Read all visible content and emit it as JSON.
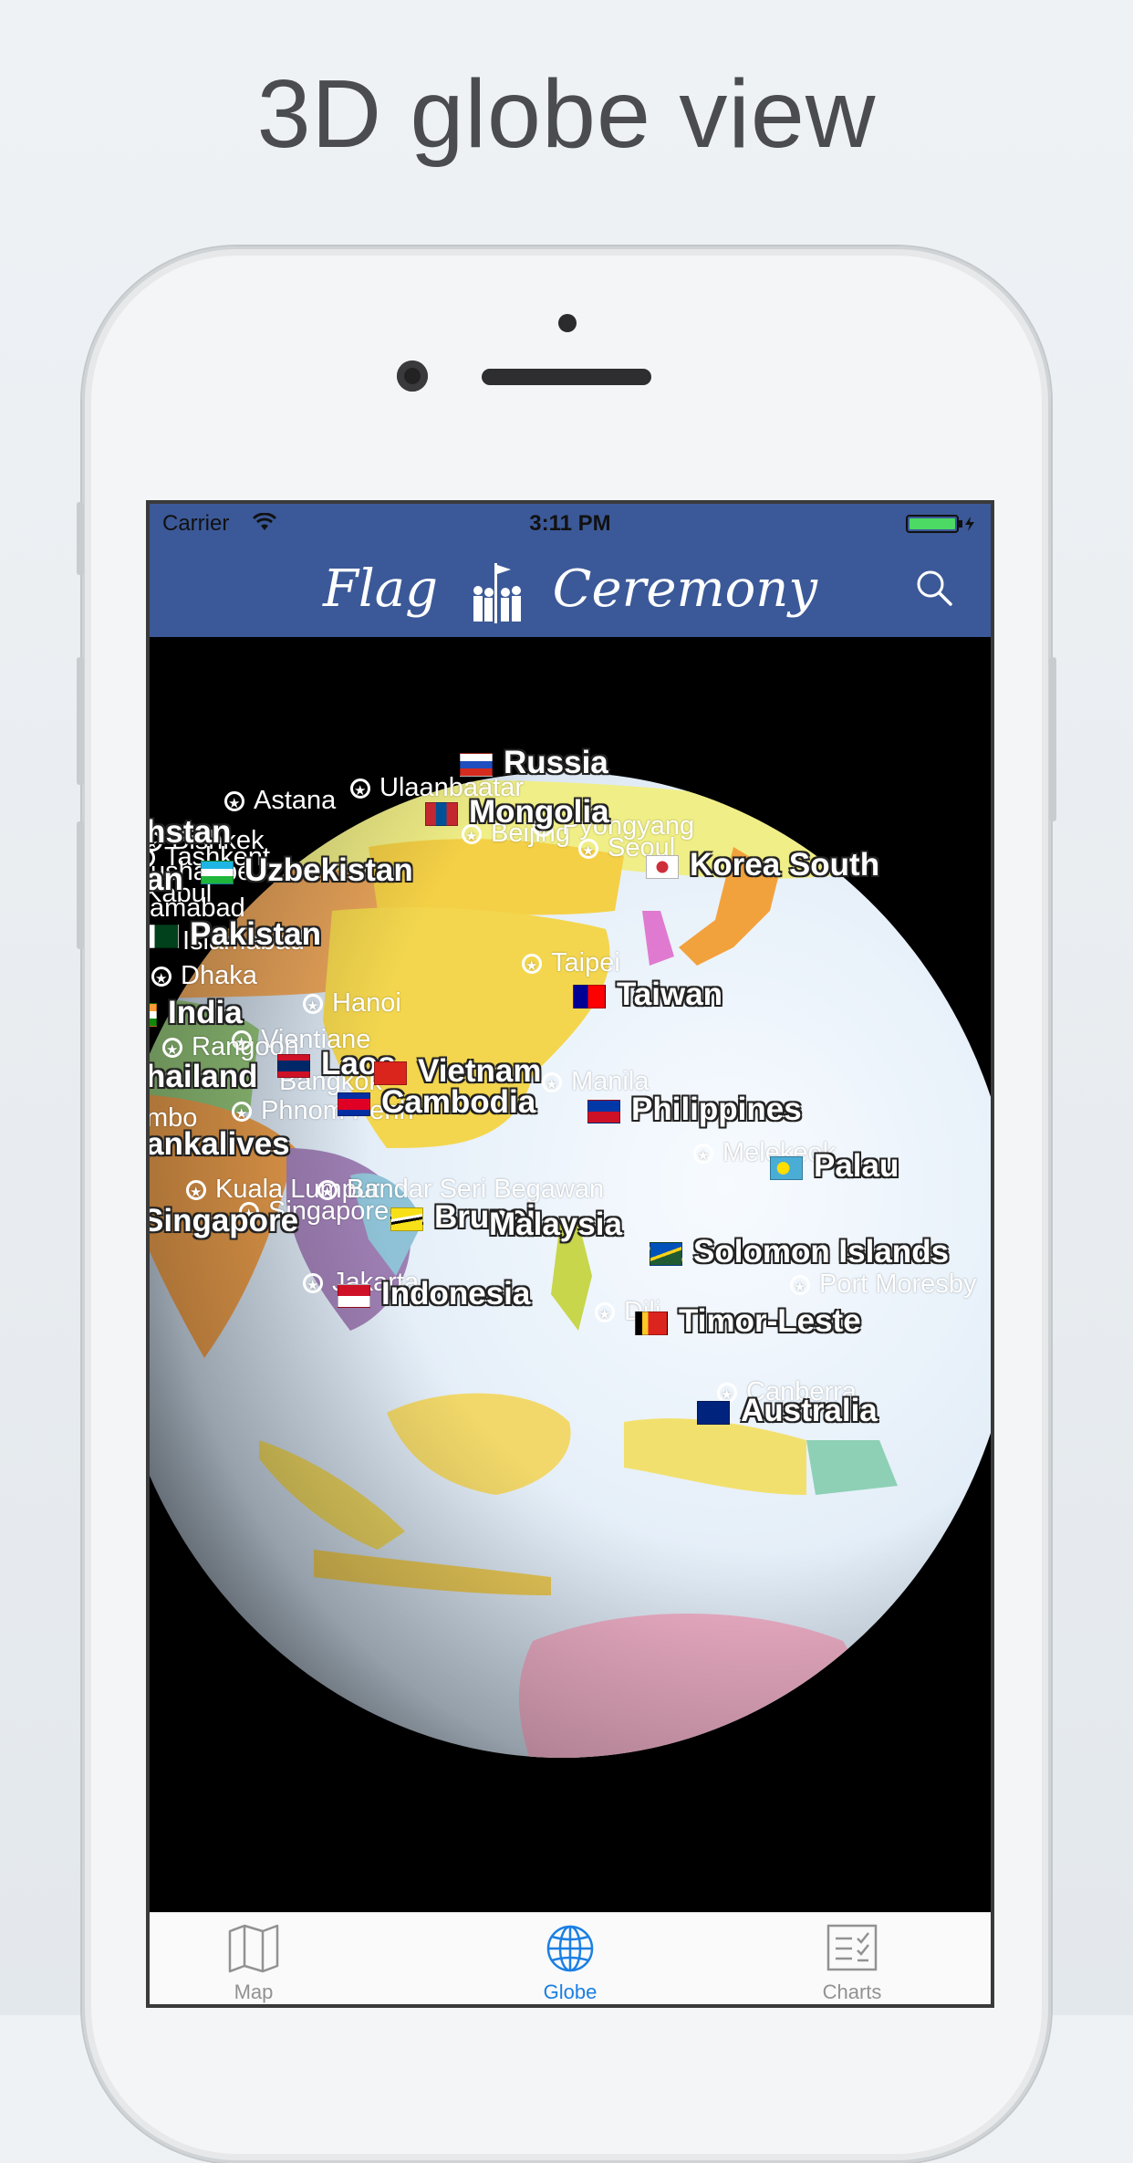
{
  "headline": "3D globe view",
  "status_bar": {
    "carrier": "Carrier",
    "time": "3:11 PM"
  },
  "nav": {
    "title_left": "Flag",
    "title_right": "Ceremony"
  },
  "countries": [
    {
      "name": "Russia",
      "flag": "ru"
    },
    {
      "name": "Mongolia",
      "flag": "mn"
    },
    {
      "name": "hstan",
      "flag": ""
    },
    {
      "name": "Uzbekistan",
      "flag": "uz"
    },
    {
      "name": "an",
      "flag": ""
    },
    {
      "name": "Korea South",
      "flag": "kr"
    },
    {
      "name": "Pakistan",
      "flag": "pk"
    },
    {
      "name": "India",
      "flag": "in"
    },
    {
      "name": "Taiwan",
      "flag": "tw"
    },
    {
      "name": "hailand",
      "flag": ""
    },
    {
      "name": "Laos",
      "flag": "la"
    },
    {
      "name": "Vietnam",
      "flag": "vn"
    },
    {
      "name": "Cambodia",
      "flag": "kh"
    },
    {
      "name": "Philippines",
      "flag": "ph"
    },
    {
      "name": "ankalives",
      "flag": ""
    },
    {
      "name": "Palau",
      "flag": "pw"
    },
    {
      "name": "Singapore",
      "flag": ""
    },
    {
      "name": "Brunei",
      "flag": "bn"
    },
    {
      "name": "Malaysia",
      "flag": ""
    },
    {
      "name": "Solomon Islands",
      "flag": "sb"
    },
    {
      "name": "Indonesia",
      "flag": "id"
    },
    {
      "name": "Timor-Leste",
      "flag": "tl"
    },
    {
      "name": "Australia",
      "flag": "au"
    }
  ],
  "cities": [
    "Astana",
    "Ulaanbaatar",
    "Bishkek",
    "Tashkent",
    "Beijing",
    "Pyongyang",
    "Seoul",
    "Dushanbe",
    "Kabul",
    "amabad",
    "Islamabad",
    "Dhaka",
    "Taipei",
    "Hanoi",
    "Vientiane",
    "Rangoon",
    "Bangkok",
    "Manila",
    "Phnom Penh",
    "mbo",
    "Melekeok",
    "Kuala Lumpur",
    "Bandar Seri Begawan",
    "Singapore",
    "Jakarta",
    "Port Moresby",
    "Dili",
    "Canberra"
  ],
  "tabs": [
    {
      "label": "Map",
      "icon": "map-icon",
      "active": false
    },
    {
      "label": "Globe",
      "icon": "globe-icon",
      "active": true
    },
    {
      "label": "Charts",
      "icon": "charts-icon",
      "active": false
    }
  ],
  "colors": {
    "nav_background": "#3b5998",
    "tab_active": "#1a7fe3",
    "tab_inactive": "#929292",
    "ocean": "#dde9f5",
    "battery": "#4cd964"
  }
}
